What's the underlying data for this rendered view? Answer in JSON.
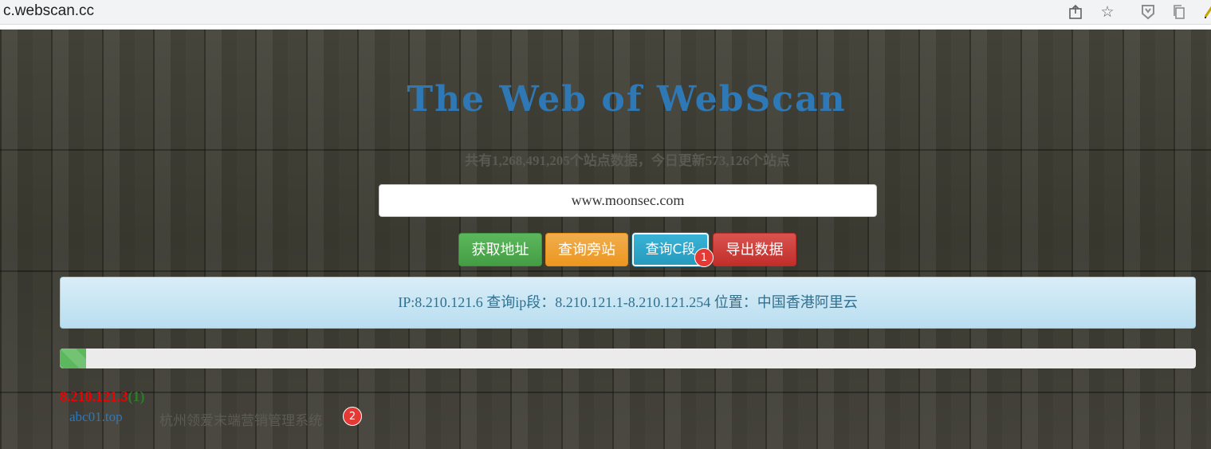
{
  "browser": {
    "url": "c.webscan.cc",
    "icons": [
      "share-icon",
      "star-icon",
      "extension-icon",
      "copy-icon",
      "pen-icon"
    ]
  },
  "page": {
    "title": "The Web of WebScan",
    "stats": "共有1,268,491,205个站点数据，今日更新573,126个站点",
    "search_value": "www.moonsec.com",
    "buttons": {
      "get_address": "获取地址",
      "query_side": "查询旁站",
      "query_c": "查询C段",
      "export": "导出数据"
    },
    "badge1": "1",
    "badge2": "2",
    "info": "IP:8.210.121.6 查询ip段：8.210.121.1-8.210.121.254 位置：中国香港阿里云",
    "progress_percent": 2.3,
    "result": {
      "ip": "8.210.121.3",
      "count": "(1)",
      "domain": "abc01.top",
      "site_title": "杭州领爱末端营销管理系统"
    }
  },
  "colors": {
    "title": "#2f78b6",
    "green": "#5cb85c",
    "orange": "#f0ad4e",
    "blue": "#39b3d7",
    "red": "#d9534f",
    "badge": "#e53935"
  }
}
